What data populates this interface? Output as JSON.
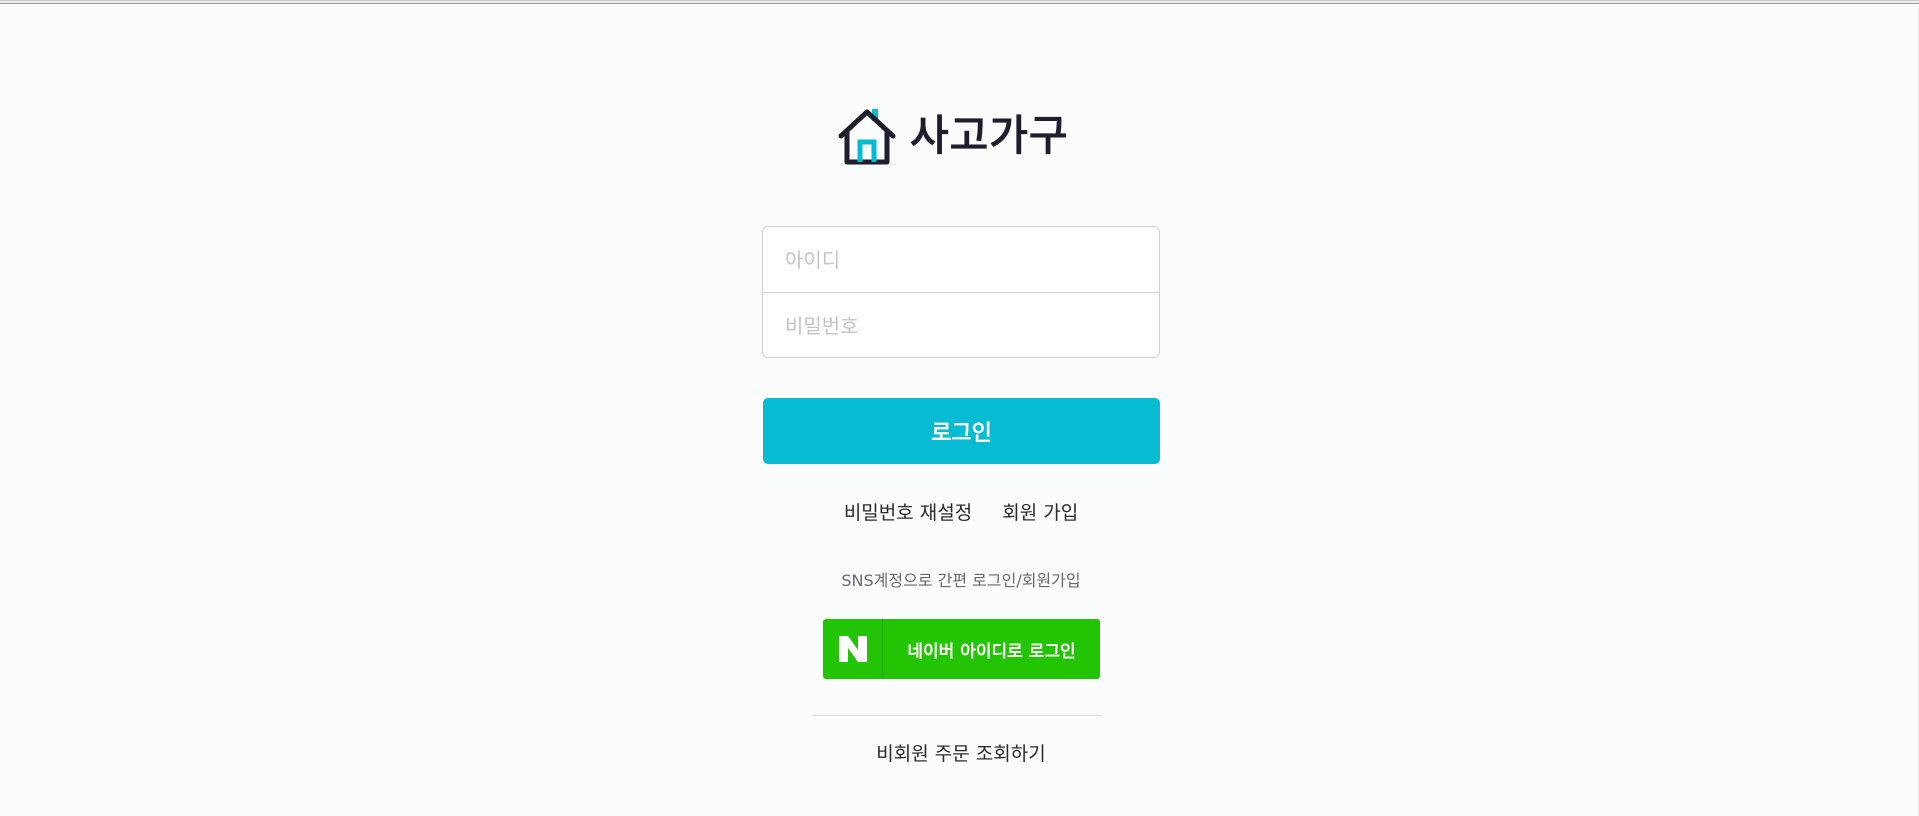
{
  "brand": {
    "name": "사고가구",
    "logo_icon": "house-icon",
    "primary_color": "#07bbd2",
    "dark_color": "#1e1e2c"
  },
  "login_form": {
    "id_placeholder": "아이디",
    "password_placeholder": "비밀번호",
    "id_value": "",
    "password_value": "",
    "submit_label": "로그인"
  },
  "links": {
    "reset_password": "비밀번호 재설정",
    "signup": "회원 가입"
  },
  "sns": {
    "caption": "SNS계정으로 간편 로그인/회원가입",
    "naver_label": "네이버 아이디로 로그인",
    "naver_icon": "naver-n-icon",
    "naver_color": "#23c403"
  },
  "guest": {
    "order_lookup": "비회원 주문 조회하기"
  }
}
